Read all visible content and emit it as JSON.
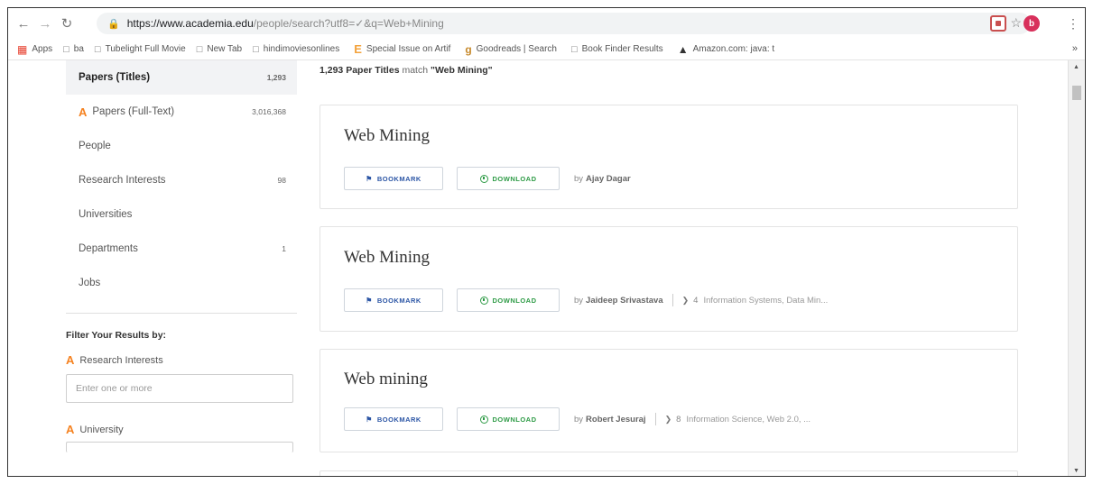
{
  "browser": {
    "url_host": "https://www.academia.edu",
    "url_path": "/people/search?utf8=✓&q=Web+Mining",
    "bookmarks": [
      {
        "label": "Apps",
        "icon": "apps-grid-icon"
      },
      {
        "label": "ba",
        "icon": "page-icon"
      },
      {
        "label": "Tubelight Full Movie",
        "icon": "page-icon"
      },
      {
        "label": "New Tab",
        "icon": "page-icon"
      },
      {
        "label": "hindimoviesonlines",
        "icon": "page-icon"
      },
      {
        "label": "Special Issue on Artif",
        "icon": "e-logo-icon"
      },
      {
        "label": "Goodreads | Search",
        "icon": "goodreads-icon"
      },
      {
        "label": "Book Finder Results",
        "icon": "page-icon"
      },
      {
        "label": "Amazon.com: java: t",
        "icon": "amazon-icon"
      }
    ],
    "more_label": "»",
    "profile_initial": "b"
  },
  "sidebar": {
    "items": [
      {
        "label": "Papers (Titles)",
        "count": "1,293",
        "active": true
      },
      {
        "label": "Papers (Full-Text)",
        "count": "3,016,368",
        "logo": "A"
      },
      {
        "label": "People",
        "count": ""
      },
      {
        "label": "Research Interests",
        "count": "98"
      },
      {
        "label": "Universities",
        "count": ""
      },
      {
        "label": "Departments",
        "count": "1"
      },
      {
        "label": "Jobs",
        "count": ""
      }
    ],
    "filter_title": "Filter Your Results by:",
    "research_label": "Research Interests",
    "research_placeholder": "Enter one or more",
    "university_label": "University",
    "logo_letter": "A"
  },
  "main": {
    "count_number": "1,293 Paper Titles",
    "count_text": " match ",
    "count_query": "\"Web Mining\"",
    "bookmark_label": "BOOKMARK",
    "download_label": "DOWNLOAD",
    "by_label": "by",
    "results": [
      {
        "title": "Web Mining",
        "author": "Ajay Dagar",
        "tag_count": "",
        "tags": ""
      },
      {
        "title": "Web Mining",
        "author": "Jaideep Srivastava",
        "tag_count": "4",
        "tags": "Information Systems, Data Min..."
      },
      {
        "title": "Web mining",
        "author": "Robert Jesuraj",
        "tag_count": "8",
        "tags": "Information Science, Web 2.0, ..."
      }
    ]
  }
}
